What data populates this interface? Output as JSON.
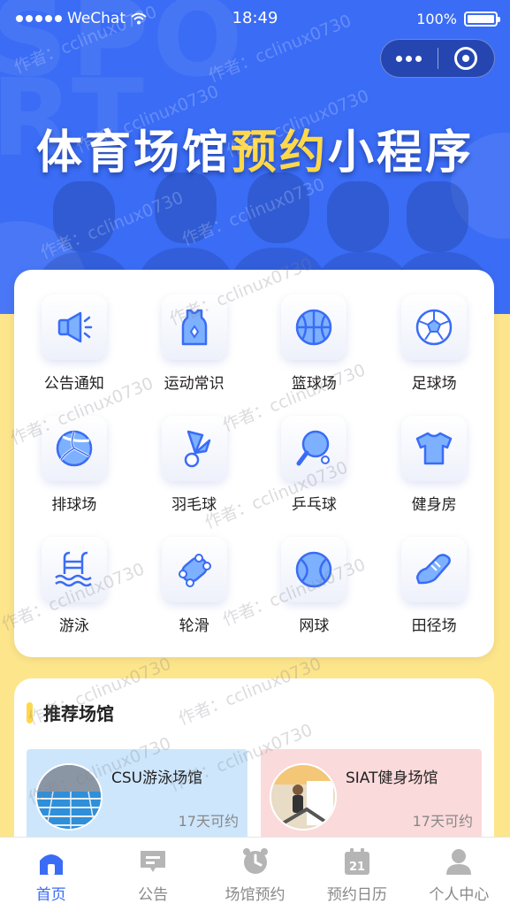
{
  "status_bar": {
    "carrier": "WeChat",
    "time": "18:49",
    "battery": "100%"
  },
  "hero": {
    "title_part1": "体育场馆",
    "title_highlight": "预约",
    "title_part2": "小程序"
  },
  "colors": {
    "primary": "#3a6cf5",
    "highlight": "#ffd84a",
    "background": "#fde58b",
    "tab_inactive": "#888888"
  },
  "grid": [
    {
      "label": "公告通知",
      "icon": "megaphone-icon"
    },
    {
      "label": "运动常识",
      "icon": "jersey-icon"
    },
    {
      "label": "篮球场",
      "icon": "basketball-icon"
    },
    {
      "label": "足球场",
      "icon": "soccer-ball-icon"
    },
    {
      "label": "排球场",
      "icon": "volleyball-icon"
    },
    {
      "label": "羽毛球",
      "icon": "shuttlecock-icon"
    },
    {
      "label": "乒乓球",
      "icon": "ping-pong-paddle-icon"
    },
    {
      "label": "健身房",
      "icon": "tshirt-icon"
    },
    {
      "label": "游泳",
      "icon": "swimming-pool-icon"
    },
    {
      "label": "轮滑",
      "icon": "skateboard-icon"
    },
    {
      "label": "网球",
      "icon": "tennis-ball-icon"
    },
    {
      "label": "田径场",
      "icon": "running-shoe-icon"
    }
  ],
  "recommend": {
    "title": "推荐场馆",
    "venues": [
      {
        "name": "CSU游泳场馆",
        "availability": "17天可约"
      },
      {
        "name": "SIAT健身场馆",
        "availability": "17天可约"
      }
    ]
  },
  "tabbar": [
    {
      "label": "首页",
      "icon": "home-icon",
      "active": true
    },
    {
      "label": "公告",
      "icon": "notice-icon",
      "active": false
    },
    {
      "label": "场馆预约",
      "icon": "alarm-clock-icon",
      "active": false
    },
    {
      "label": "预约日历",
      "icon": "calendar-icon",
      "active": false
    },
    {
      "label": "个人中心",
      "icon": "user-icon",
      "active": false
    }
  ],
  "watermark": "作者：cclinux0730"
}
